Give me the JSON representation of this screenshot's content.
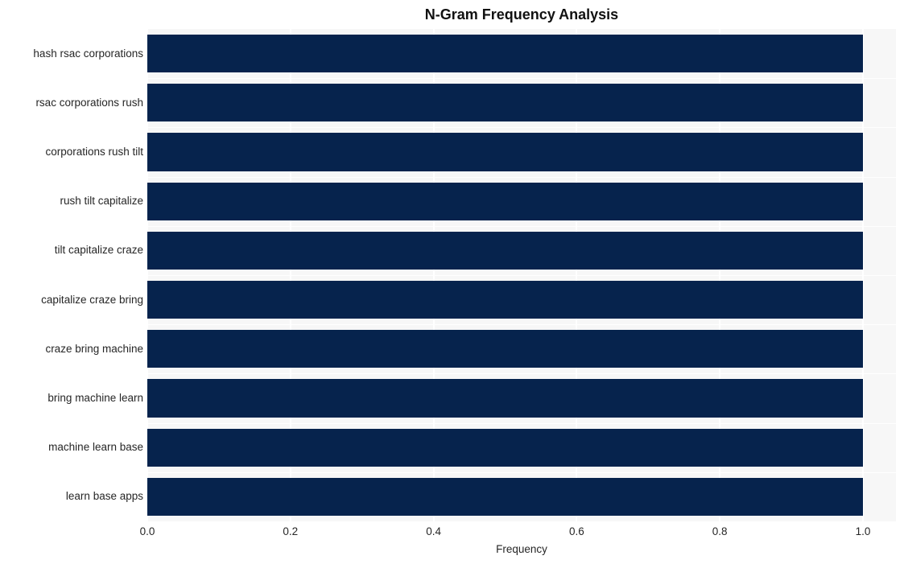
{
  "chart_data": {
    "type": "bar",
    "orientation": "horizontal",
    "title": "N-Gram Frequency Analysis",
    "xlabel": "Frequency",
    "ylabel": "",
    "categories": [
      "hash rsac corporations",
      "rsac corporations rush",
      "corporations rush tilt",
      "rush tilt capitalize",
      "tilt capitalize craze",
      "capitalize craze bring",
      "craze bring machine",
      "bring machine learn",
      "machine learn base",
      "learn base apps"
    ],
    "values": [
      1.0,
      1.0,
      1.0,
      1.0,
      1.0,
      1.0,
      1.0,
      1.0,
      1.0,
      1.0
    ],
    "xlim": [
      0.0,
      1.0
    ],
    "xticks": [
      "0.0",
      "0.2",
      "0.4",
      "0.6",
      "0.8",
      "1.0"
    ],
    "xtick_values": [
      0.0,
      0.2,
      0.4,
      0.6,
      0.8,
      1.0
    ],
    "grid": true,
    "legend": false,
    "colors": {
      "bar": "#06234d",
      "plot_background": "#f7f7f7",
      "gridline": "#ffffff",
      "text": "#262626",
      "title": "#111111",
      "page_background": "#ffffff"
    }
  }
}
